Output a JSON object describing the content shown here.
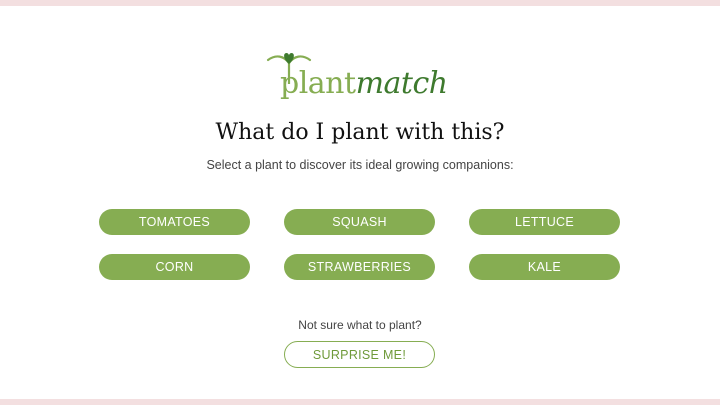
{
  "brand": {
    "name_part1": "plant",
    "name_part2": "match",
    "green_light": "#86ad52",
    "green_dark": "#3e7a2e",
    "border_pink": "#f3dfe0"
  },
  "logo_icon": "heart-sprout-icon",
  "title": "What do I plant with this?",
  "subtitle": "Select a plant to discover its ideal growing companions:",
  "plants": [
    "TOMATOES",
    "SQUASH",
    "LETTUCE",
    "CORN",
    "STRAWBERRIES",
    "KALE"
  ],
  "prompt": "Not sure what to plant?",
  "surprise_label": "SURPRISE ME!"
}
